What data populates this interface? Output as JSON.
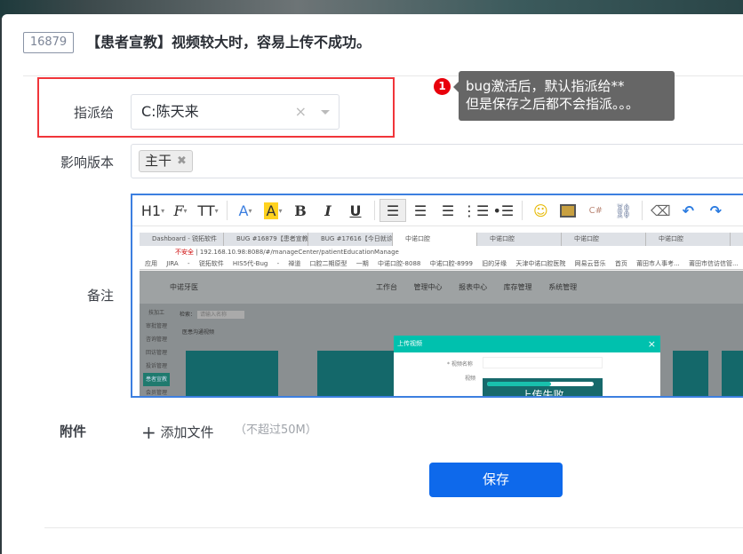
{
  "issue": {
    "id": "16879",
    "title": "【患者宣教】视频较大时，容易上传不成功。"
  },
  "assign": {
    "label": "指派给",
    "value": "C:陈天来",
    "clear_icon": "×"
  },
  "annotation": {
    "number": "1",
    "line1": "bug激活后，默认指派给**",
    "line2": "但是保存之后都不会指派。。。"
  },
  "version": {
    "label": "影响版本",
    "tags": [
      "主干"
    ]
  },
  "remark": {
    "label": "备注",
    "toolbar": [
      "H1",
      "F",
      "TT",
      "A",
      "A",
      "B",
      "I",
      "U"
    ],
    "screenshot": {
      "tabs": [
        "Dashboard - 锐拓软件",
        "BUG #16879【患者宣教】",
        "BUG #17616【今日就诊】",
        "中诺口腔",
        "中诺口腔",
        "中诺口腔",
        "中诺口腔"
      ],
      "insecure": "不安全",
      "url": "192.168.10.98:8088/#/manageCenter/patientEducationManage",
      "bookmarks": "应用 JIRA - 锐拓软件 HIS5代-Bug - 禅道 口腔二期原型 一期 中诺口腔-8088 中诺口腔-8999 旧的牙缘 天津中诺口腔医院 网易云音乐 首页 莆田市人事考... 莆田市信访信管... 门诊医生工",
      "app_name": "中诺牙医",
      "nav": [
        "工作台",
        "管理中心",
        "报表中心",
        "库存管理",
        "系统管理"
      ],
      "side": [
        "技加工",
        "审批管理",
        "咨询管理",
        "回访管理",
        "投诉管理",
        "患者宣教",
        "会员管理"
      ],
      "search_label": "检索：",
      "search_placeholder": "请输入名称",
      "section": "医患沟通视频",
      "dialog_title": "上传视频",
      "field_name": "* 视频名称",
      "field_video": "视频",
      "upload_status": "上传失败",
      "upload_progress": 0.6
    }
  },
  "attachment": {
    "label": "附件",
    "add": "添加文件",
    "hint": "（不超过50M）"
  },
  "save_label": "保存"
}
